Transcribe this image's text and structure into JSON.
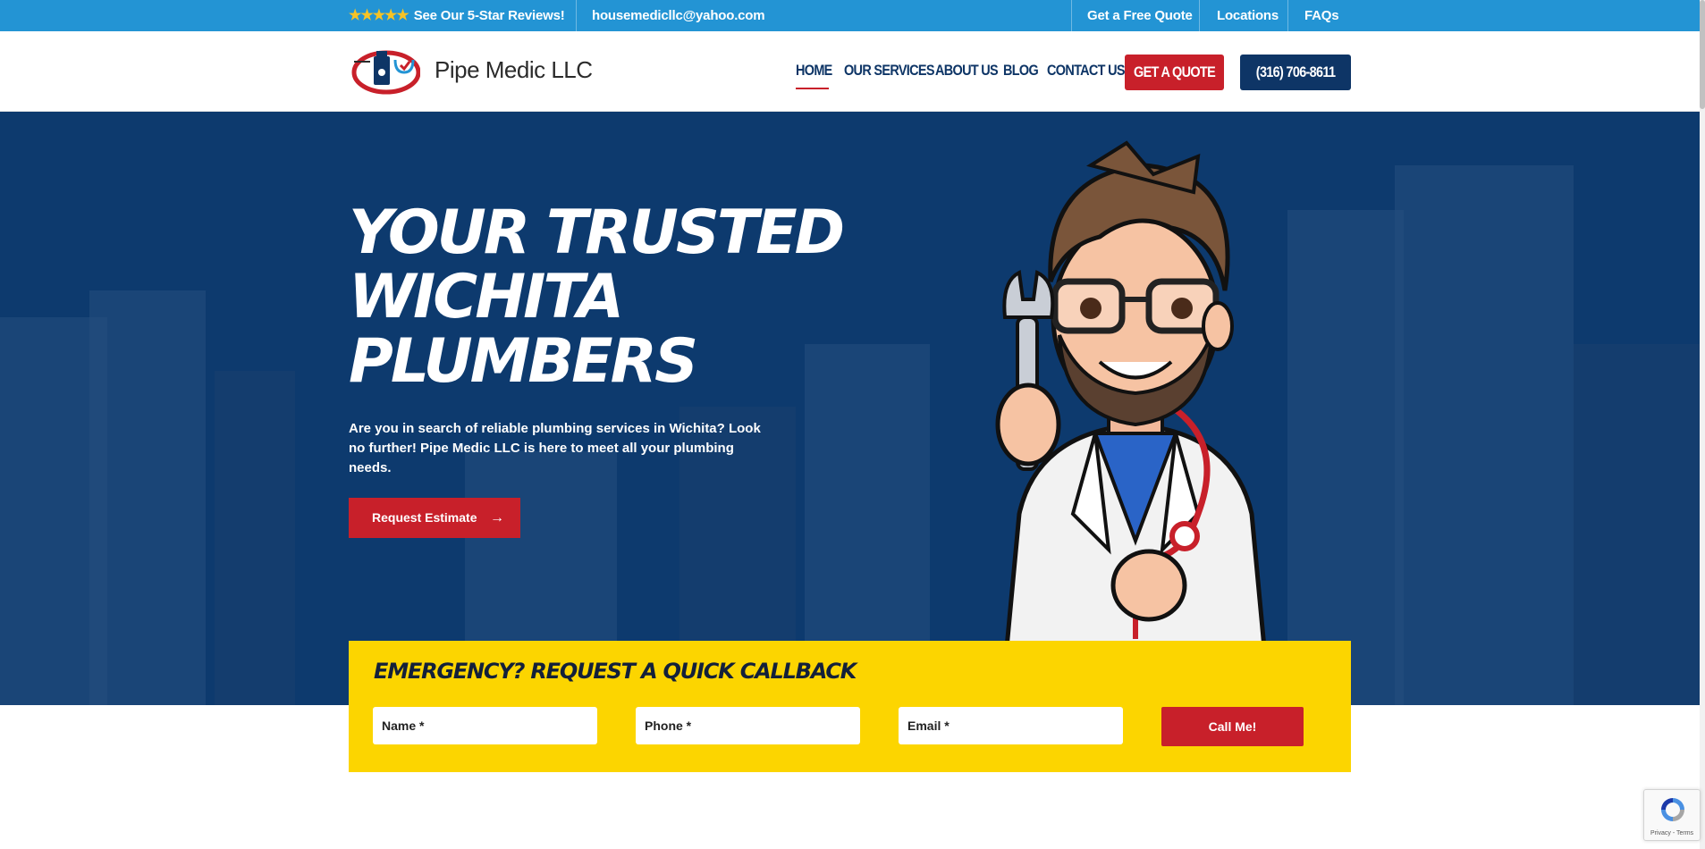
{
  "colors": {
    "topbar": "#2394d4",
    "navy": "#0e3566",
    "red": "#c8202a",
    "yellow": "#fcd500",
    "star": "#f7c325"
  },
  "topbar": {
    "stars": "★★★★★",
    "reviews_label": "See Our 5-Star Reviews!",
    "email": "housemedicllc@yahoo.com",
    "free_quote": "Get a Free Quote",
    "locations": "Locations",
    "faqs": "FAQs"
  },
  "header": {
    "brand": "Pipe Medic LLC",
    "nav": [
      "HOME",
      "OUR SERVICES",
      "ABOUT US",
      "BLOG",
      "CONTACT US"
    ],
    "active_nav": "HOME",
    "quote_button": "GET A QUOTE",
    "phone_button": "(316) 706-8611"
  },
  "hero": {
    "title_lines": [
      "YOUR TRUSTED",
      "WICHITA",
      "PLUMBERS"
    ],
    "text": "Are you in search of reliable plumbing services in Wichita? Look no further! Pipe Medic LLC is here to meet all your plumbing needs.",
    "button": "Request Estimate",
    "button_icon": "arrow-right-icon"
  },
  "callback": {
    "title": "EMERGENCY? REQUEST A QUICK CALLBACK",
    "fields": [
      {
        "placeholder": "Name *"
      },
      {
        "placeholder": "Phone *"
      },
      {
        "placeholder": "Email *"
      }
    ],
    "submit": "Call Me!"
  },
  "recaptcha": {
    "footer": "Privacy - Terms"
  }
}
